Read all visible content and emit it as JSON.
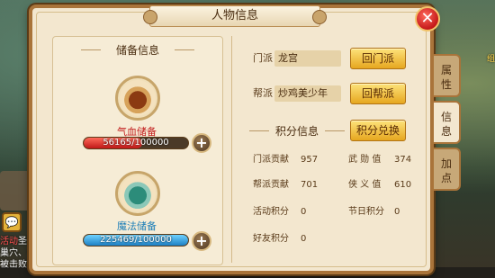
{
  "window": {
    "title": "人物信息"
  },
  "close_icon": "close-icon",
  "storage": {
    "section_title": "储备信息",
    "hp": {
      "label": "气血储备",
      "value_text": "56165/100000",
      "current": 56165,
      "max": 100000,
      "color": "#c01818"
    },
    "mp": {
      "label": "魔法储备",
      "value_text": "225469/100000",
      "current": 225469,
      "max": 100000,
      "color": "#1c7fc4"
    },
    "plus_icon": "plus-icon"
  },
  "sect": {
    "label": "门派",
    "value": "龙宫",
    "button": "回门派"
  },
  "guild": {
    "label": "帮派",
    "value": "炒鸡美少年",
    "button": "回帮派"
  },
  "points": {
    "section_title": "积分信息",
    "exchange_button": "积分兑换",
    "items": [
      {
        "label": "门派贡献",
        "value": "957"
      },
      {
        "label": "武 勋 值",
        "value": "374"
      },
      {
        "label": "帮派贡献",
        "value": "701"
      },
      {
        "label": "侠 义 值",
        "value": "610"
      },
      {
        "label": "活动积分",
        "value": "0"
      },
      {
        "label": "节日积分",
        "value": "0"
      },
      {
        "label": "好友积分",
        "value": "0"
      }
    ]
  },
  "side_tabs": [
    {
      "label": "属\n性",
      "active": false
    },
    {
      "label": "信\n息",
      "active": true
    },
    {
      "label": "加\n点",
      "active": false
    }
  ],
  "background_hud": {
    "left_text_red": "活动",
    "left_text": "圣诞树",
    "left_text2": "巢穴、一大",
    "left_text3": "被击败",
    "chat_icon": "chat-icon",
    "right_text": "组"
  }
}
